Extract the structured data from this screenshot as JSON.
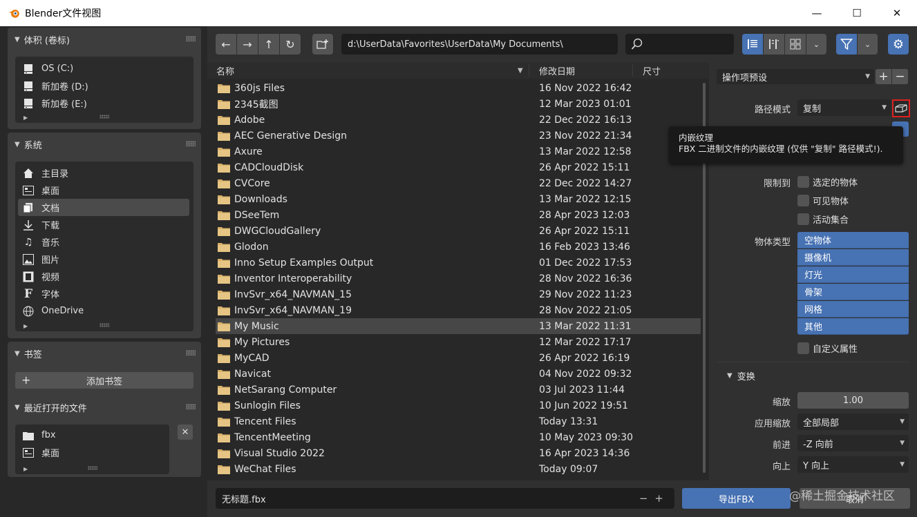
{
  "window": {
    "title": "Blender文件视图",
    "minimize": "—",
    "maximize": "☐",
    "close": "✕"
  },
  "sidebar": {
    "volumes": {
      "header": "体积 (卷标)",
      "items": [
        {
          "label": "OS (C:)",
          "icon": "drive-icon"
        },
        {
          "label": "新加卷 (D:)",
          "icon": "drive-icon"
        },
        {
          "label": "新加卷 (E:)",
          "icon": "drive-icon"
        }
      ]
    },
    "system": {
      "header": "系统",
      "items": [
        {
          "label": "主目录",
          "icon": "home-icon"
        },
        {
          "label": "桌面",
          "icon": "desktop-icon"
        },
        {
          "label": "文档",
          "icon": "documents-icon",
          "active": true
        },
        {
          "label": "下载",
          "icon": "download-icon"
        },
        {
          "label": "音乐",
          "icon": "music-icon"
        },
        {
          "label": "图片",
          "icon": "image-icon"
        },
        {
          "label": "视频",
          "icon": "video-icon"
        },
        {
          "label": "字体",
          "icon": "font-icon"
        },
        {
          "label": "OneDrive",
          "icon": "globe-icon"
        }
      ]
    },
    "bookmarks": {
      "header": "书签",
      "add_label": "添加书签"
    },
    "recent": {
      "header": "最近打开的文件",
      "items": [
        {
          "label": "fbx",
          "icon": "folder-icon"
        },
        {
          "label": "桌面",
          "icon": "desktop-icon"
        }
      ]
    }
  },
  "toolbar": {
    "path": "d:\\UserData\\Favorites\\UserData\\My Documents\\",
    "search_value": ""
  },
  "filelist": {
    "columns": {
      "name": "名称",
      "date": "修改日期",
      "size": "尺寸"
    },
    "rows": [
      {
        "name": "360js Files",
        "date": "16 Nov 2022 16:42"
      },
      {
        "name": "2345截图",
        "date": "12 Mar 2023 01:01"
      },
      {
        "name": "Adobe",
        "date": "22 Dec 2022 16:13"
      },
      {
        "name": "AEC Generative Design",
        "date": "23 Nov 2022 21:34"
      },
      {
        "name": "Axure",
        "date": "13 Mar 2022 12:58"
      },
      {
        "name": "CADCloudDisk",
        "date": "26 Apr 2022 15:11"
      },
      {
        "name": "CVCore",
        "date": "22 Dec 2022 14:27"
      },
      {
        "name": "Downloads",
        "date": "13 Mar 2022 12:15"
      },
      {
        "name": "DSeeTem",
        "date": "28 Apr 2023 12:03"
      },
      {
        "name": "DWGCloudGallery",
        "date": "26 Apr 2022 15:11"
      },
      {
        "name": "Glodon",
        "date": "16 Feb 2023 13:46"
      },
      {
        "name": "Inno Setup Examples Output",
        "date": "01 Dec 2022 17:53"
      },
      {
        "name": "Inventor Interoperability",
        "date": "28 Nov 2022 16:36"
      },
      {
        "name": "InvSvr_x64_NAVMAN_15",
        "date": "29 Nov 2022 11:23"
      },
      {
        "name": "InvSvr_x64_NAVMAN_19",
        "date": "28 Nov 2022 21:05"
      },
      {
        "name": "My Music",
        "date": "13 Mar 2022 11:31",
        "selected": true
      },
      {
        "name": "My Pictures",
        "date": "12 Mar 2022 17:17"
      },
      {
        "name": "MyCAD",
        "date": "26 Apr 2022 16:19"
      },
      {
        "name": "Navicat",
        "date": "04 Nov 2022 09:32"
      },
      {
        "name": "NetSarang Computer",
        "date": "03 Jul 2023 11:44"
      },
      {
        "name": "Sunlogin Files",
        "date": "10 Jun 2022 19:51"
      },
      {
        "name": "Tencent Files",
        "date": "Today 13:31"
      },
      {
        "name": "TencentMeeting",
        "date": "10 May 2023 09:30"
      },
      {
        "name": "Visual Studio 2022",
        "date": "16 Apr 2023 14:36"
      },
      {
        "name": "WeChat Files",
        "date": "Today 09:07"
      }
    ]
  },
  "bottom": {
    "filename": "无标题.fbx",
    "export_label": "导出FBX",
    "cancel_label": "取消",
    "watermark": "@稀土掘金技术社区"
  },
  "properties": {
    "preset_label": "操作项预设",
    "path_mode_label": "路径模式",
    "path_mode_value": "复制",
    "tooltip_title": "内嵌纹理",
    "tooltip_body": "FBX 二进制文件的内嵌纹理 (仅供 \"复制\" 路径模式!).",
    "limit_label": "限制到",
    "limit_options": [
      "选定的物体",
      "可见物体",
      "活动集合"
    ],
    "object_types_label": "物体类型",
    "object_types": [
      "空物体",
      "摄像机",
      "灯光",
      "骨架",
      "网格",
      "其他"
    ],
    "custom_props": "自定义属性",
    "transform_header": "变换",
    "scale_label": "缩放",
    "scale_value": "1.00",
    "apply_scale_label": "应用缩放",
    "apply_scale_value": "全部局部",
    "forward_label": "前进",
    "forward_value": "-Z 向前",
    "up_label": "向上",
    "up_value": "Y 向上"
  },
  "colors": {
    "accent": "#4772b3",
    "highlight_border": "#e02020"
  }
}
